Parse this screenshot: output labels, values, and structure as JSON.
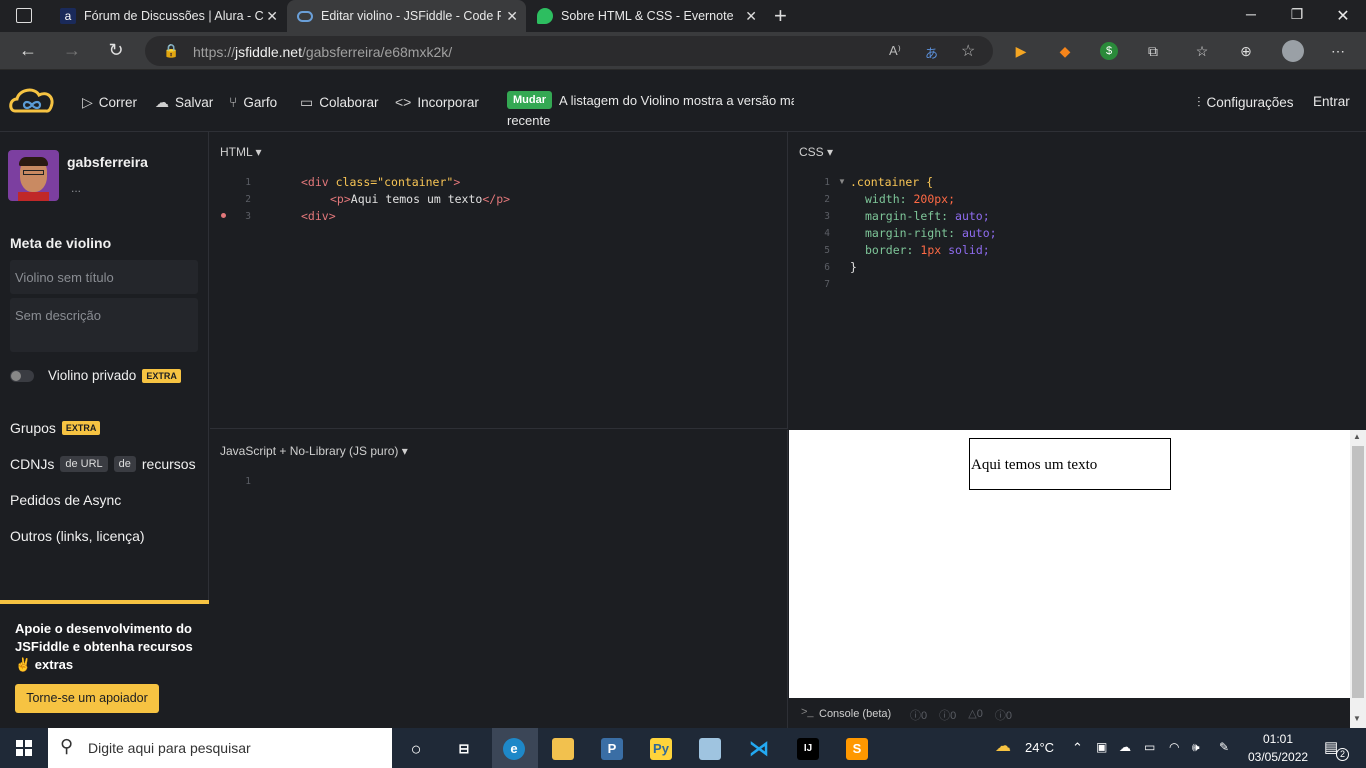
{
  "browser": {
    "tabs": [
      {
        "label": "Fórum de Discussões | Alura - Cu",
        "icon": "alura-icon",
        "icon_letter": "a"
      },
      {
        "label": "Editar violino - JSFiddle - Code P",
        "icon": "jsfiddle-icon"
      },
      {
        "label": "Sobre HTML & CSS - Evernote",
        "icon": "evernote-icon"
      }
    ],
    "new_tab": "+",
    "url_scheme": "https://",
    "url_domain": "jsfiddle.net",
    "url_path": "/gabsferreira/e68mxk2k/"
  },
  "header": {
    "run": "Correr",
    "save": "Salvar",
    "fork": "Garfo",
    "collaborate": "Colaborar",
    "embed": "Incorporar",
    "badge": "Mudar",
    "notice_line1": "A listagem do Violino mostra a versão mais",
    "notice_line2": "recente",
    "settings": "Configurações",
    "login": "Entrar"
  },
  "sidebar": {
    "username": "gabsferreira",
    "more": "...",
    "meta_title": "Meta de violino",
    "title_placeholder": "Violino sem título",
    "desc_placeholder": "Sem descrição",
    "private_label": "Violino privado",
    "extra": "EXTRA",
    "groups": "Grupos",
    "cdnjs": "CDNJs",
    "cdn_tag1": "de URL",
    "cdn_tag2": "de",
    "cdn_resources": "recursos",
    "async": "Pedidos de Async",
    "others": "Outros (links, licença)",
    "support_text": "Apoie o desenvolvimento do JSFiddle e obtenha recursos ✌ extras",
    "support_button": "Torne-se um apoiador"
  },
  "panels": {
    "html_label": "HTML ▾",
    "css_label": "CSS ▾",
    "js_label": "JavaScript + No-Library (JS puro) ▾",
    "console_label": "Console (beta)",
    "console_counts": [
      "0",
      "0",
      "0",
      "0"
    ]
  },
  "html_code": {
    "l1_tag_open": "<div ",
    "l1_attr": "class=",
    "l1_str": "\"container\"",
    "l1_end": ">",
    "l2_open": "<p>",
    "l2_text": "Aqui temos um texto",
    "l2_close": "</p>",
    "l3": "<div>"
  },
  "css_code": {
    "selector": ".container {",
    "p1": "width:",
    "v1": "200px;",
    "p2": "margin-left:",
    "v2": "auto;",
    "p3": "margin-right:",
    "v3": "auto;",
    "p4": "border:",
    "v4a": "1px",
    "v4b": "solid;",
    "close": "}"
  },
  "line_numbers": [
    "1",
    "2",
    "3",
    "4",
    "5",
    "6",
    "7"
  ],
  "result": {
    "text": "Aqui temos um texto"
  },
  "taskbar": {
    "search_placeholder": "Digite aqui para pesquisar",
    "temperature": "24°C",
    "time": "01:01",
    "date": "03/05/2022",
    "notifications": "2"
  }
}
